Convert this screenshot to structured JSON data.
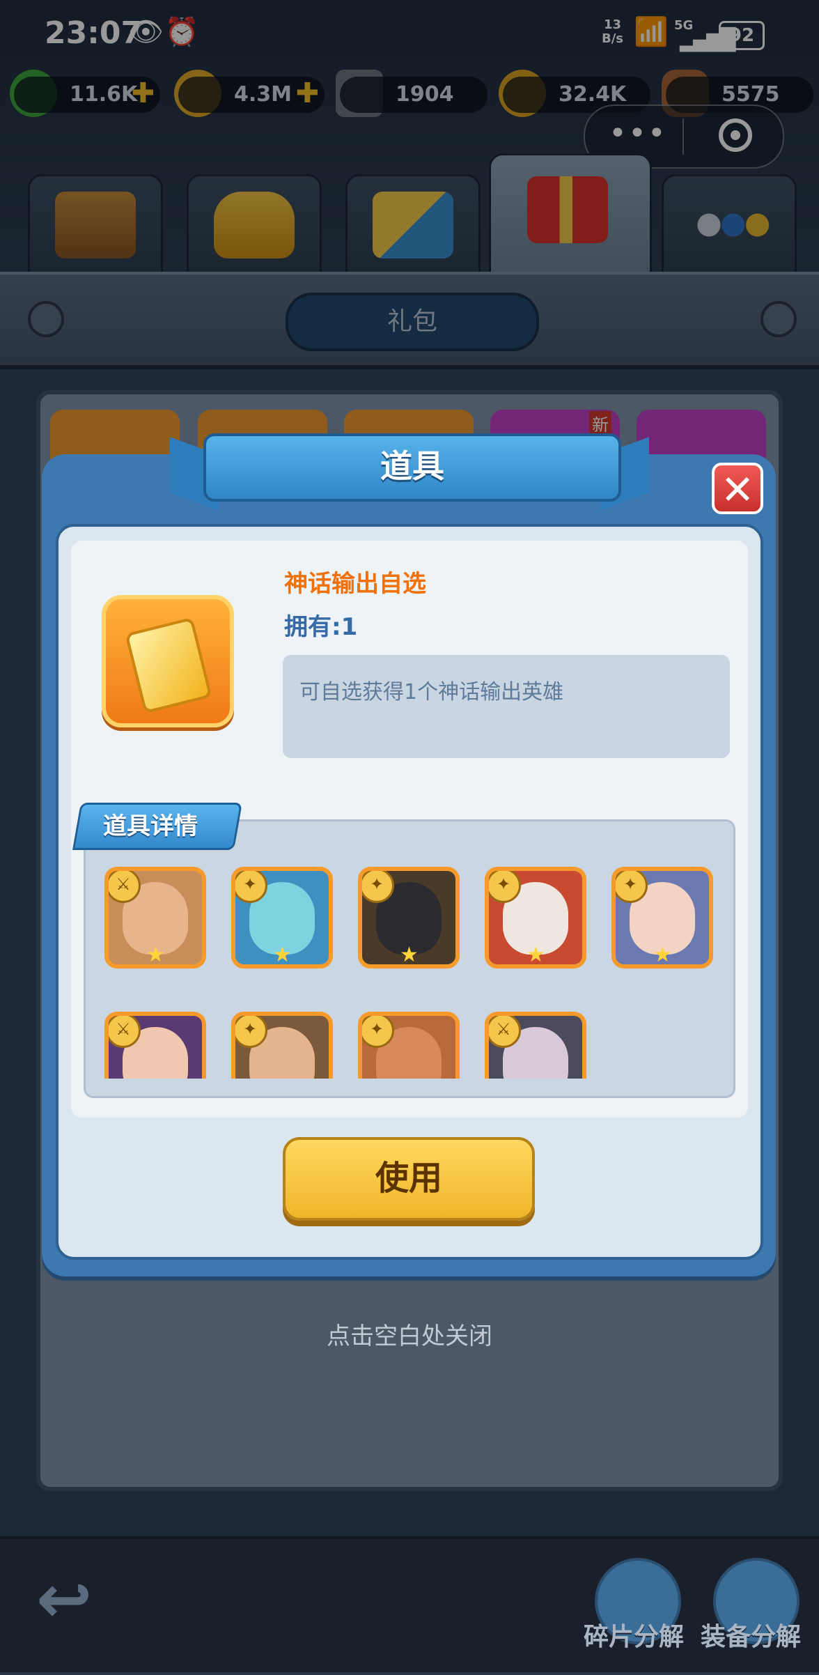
{
  "status_bar": {
    "time": "23:07",
    "net_speed": "13\nB/s",
    "network": "5G",
    "battery": "92"
  },
  "resources": [
    {
      "value": "11.6K",
      "icon": "green-gem-icon",
      "color": "#3fa53c"
    },
    {
      "value": "4.3M",
      "icon": "gold-coin-icon",
      "color": "#e0a92a"
    },
    {
      "value": "1904",
      "icon": "iron-ore-icon",
      "color": "#6e7580"
    },
    {
      "value": "32.4K",
      "icon": "star-medal-icon",
      "color": "#d8a423"
    },
    {
      "value": "5575",
      "icon": "wood-log-icon",
      "color": "#a5643a"
    }
  ],
  "header": {
    "title": "礼包"
  },
  "modal": {
    "title": "道具",
    "item_name": "神话输出自选",
    "own_count": "拥有:1",
    "description": "可自选获得1个神话输出英雄",
    "detail_tab": "道具详情",
    "use_label": "使用"
  },
  "tap_to_close": "点击空白处关闭",
  "bottom_bar": {
    "shard_decompose": "碎片分解",
    "equip_decompose": "装备分解"
  },
  "badge_new": "新",
  "heroes": [
    {
      "icon": "sword-class-icon",
      "stars": 1
    },
    {
      "icon": "staff-class-icon",
      "stars": 1
    },
    {
      "icon": "staff-class-icon",
      "stars": 1
    },
    {
      "icon": "staff-class-icon",
      "stars": 1
    },
    {
      "icon": "staff-class-icon",
      "stars": 1
    },
    {
      "icon": "sword-class-icon"
    },
    {
      "icon": "staff-class-icon"
    },
    {
      "icon": "staff-class-icon"
    },
    {
      "icon": "sword-class-icon"
    }
  ]
}
